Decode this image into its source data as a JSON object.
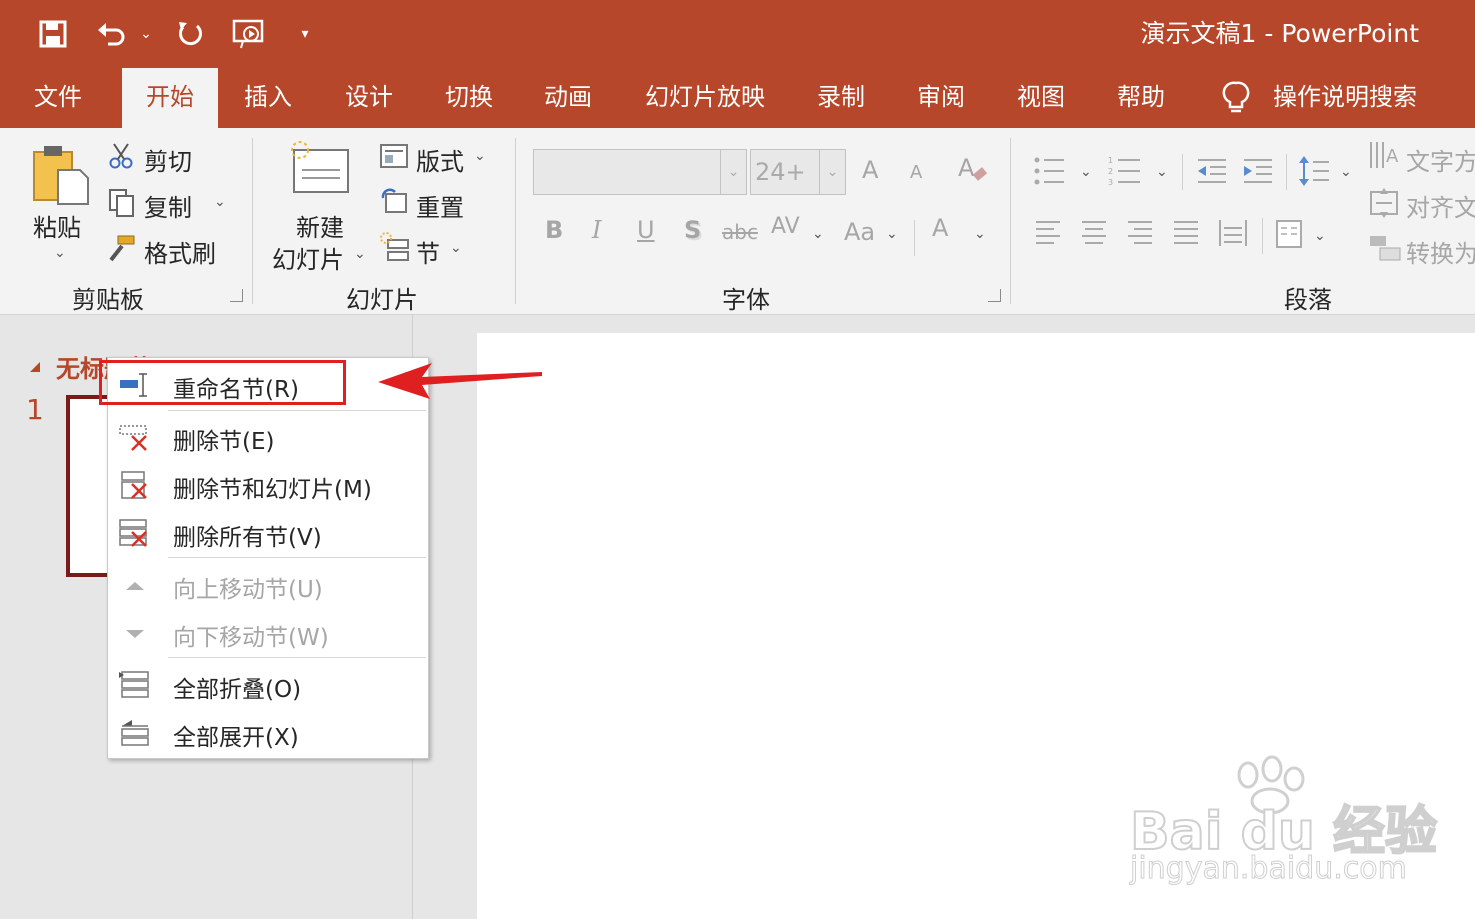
{
  "window": {
    "title": "演示文稿1  -  PowerPoint"
  },
  "tabs": [
    "文件",
    "开始",
    "插入",
    "设计",
    "切换",
    "动画",
    "幻灯片放映",
    "录制",
    "审阅",
    "视图",
    "帮助"
  ],
  "tell_me": "操作说明搜索",
  "ribbon": {
    "clipboard": {
      "paste": "粘贴",
      "cut": "剪切",
      "copy": "复制",
      "format_painter": "格式刷",
      "group": "剪贴板"
    },
    "slides": {
      "new_slide_1": "新建",
      "new_slide_2": "幻灯片",
      "layout": "版式",
      "reset": "重置",
      "section": "节",
      "group": "幻灯片"
    },
    "font": {
      "size": "24+",
      "bold": "B",
      "italic": "I",
      "underline": "U",
      "shadow": "S",
      "strike": "abc",
      "spacing": "AV",
      "case": "Aa",
      "color": "A",
      "grow": "A",
      "shrink": "A",
      "group": "字体"
    },
    "paragraph": {
      "text_direction": "文字方",
      "align_text": "对齐文",
      "convert": "转换为",
      "group": "段落"
    }
  },
  "thumbnail": {
    "section_name": "无标题节",
    "slide_number": "1"
  },
  "menu": {
    "items": [
      {
        "label": "重命名节(R)",
        "enabled": true
      },
      {
        "label": "删除节(E)",
        "enabled": true
      },
      {
        "label": "删除节和幻灯片(M)",
        "enabled": true
      },
      {
        "label": "删除所有节(V)",
        "enabled": true
      },
      {
        "label": "向上移动节(U)",
        "enabled": false
      },
      {
        "label": "向下移动节(W)",
        "enabled": false
      },
      {
        "label": "全部折叠(O)",
        "enabled": true
      },
      {
        "label": "全部展开(X)",
        "enabled": true
      }
    ]
  },
  "watermark": {
    "brand": "Bai du 经验",
    "url": "jingyan.baidu.com"
  },
  "colors": {
    "accent": "#b7472a",
    "highlight": "#e02020"
  }
}
